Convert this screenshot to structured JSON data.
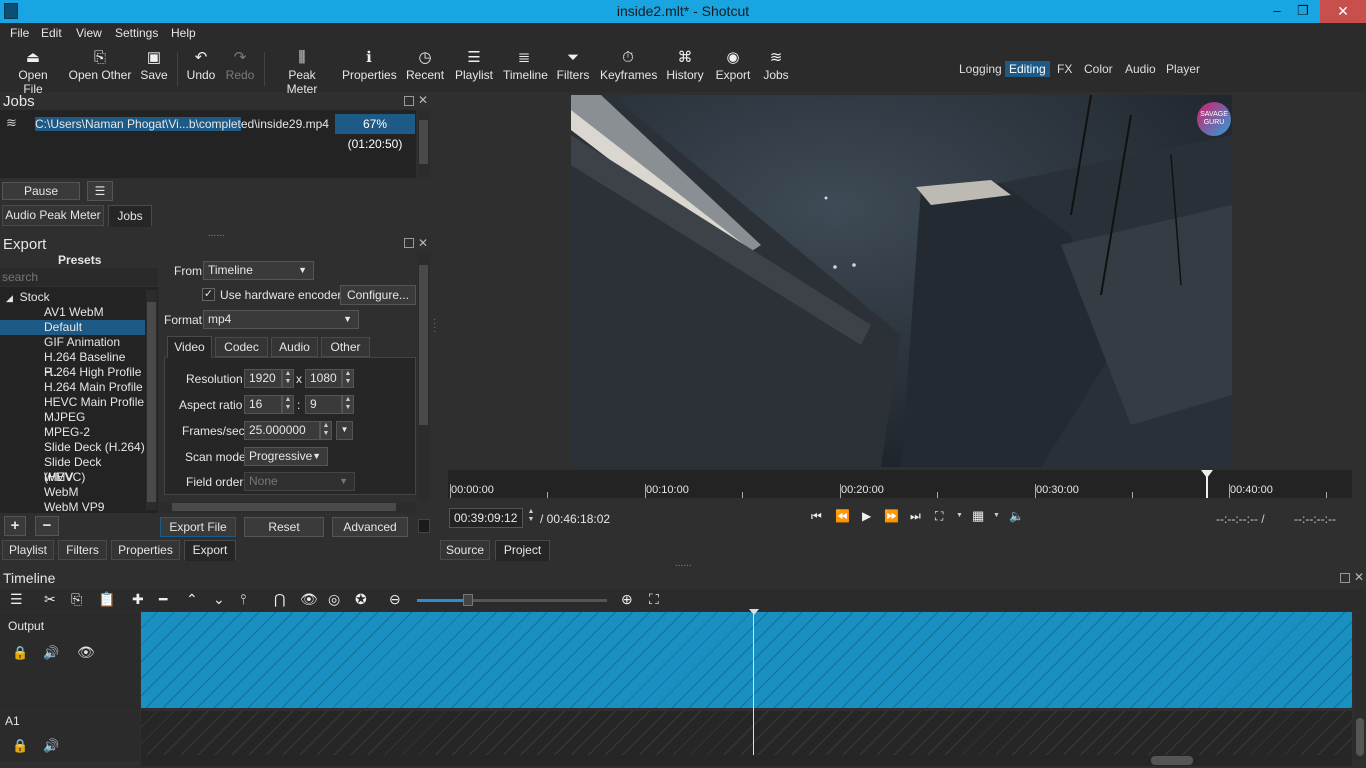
{
  "window": {
    "title": "inside2.mlt* - Shotcut",
    "controls": {
      "minimize": "–",
      "maximize": "❐",
      "close": "✕"
    }
  },
  "menu": [
    "File",
    "Edit",
    "View",
    "Settings",
    "Help"
  ],
  "toolbar": {
    "open_file": "Open File",
    "open_other": "Open Other",
    "save": "Save",
    "undo": "Undo",
    "redo": "Redo",
    "peak_meter": "Peak Meter",
    "properties": "Properties",
    "recent": "Recent",
    "playlist": "Playlist",
    "timeline": "Timeline",
    "filters": "Filters",
    "keyframes": "Keyframes",
    "history": "History",
    "export": "Export",
    "jobs": "Jobs"
  },
  "layouts": {
    "logging": "Logging",
    "editing": "Editing",
    "fx": "FX",
    "color": "Color",
    "audio": "Audio",
    "player": "Player",
    "active": "Editing"
  },
  "jobs_panel": {
    "title": "Jobs",
    "job_path_selected": "C:\\Users\\Naman Phogat\\Vi...b\\complet",
    "job_path_rest": "ed\\inside29.mp4",
    "job_progress": "67% (01:20:50)",
    "pause_button": "Pause",
    "tabs": {
      "audio_peak_meter": "Audio Peak Meter",
      "jobs": "Jobs"
    }
  },
  "export_panel": {
    "title": "Export",
    "presets_label": "Presets",
    "search_placeholder": "search",
    "stock_label": "Stock",
    "presets": [
      "AV1 WebM",
      "Default",
      "GIF Animation",
      "H.264 Baseline P...",
      "H.264 High Profile",
      "H.264 Main Profile",
      "HEVC Main Profile",
      "MJPEG",
      "MPEG-2",
      "Slide Deck (H.264)",
      "Slide Deck (HEVC)",
      "WMV",
      "WebM",
      "WebM VP9"
    ],
    "selected_preset": "Default",
    "from_label": "From",
    "from_value": "Timeline",
    "hw_encoder_label": "Use hardware encoder",
    "configure_button": "Configure...",
    "format_label": "Format",
    "format_value": "mp4",
    "tabs": {
      "video": "Video",
      "codec": "Codec",
      "audio": "Audio",
      "other": "Other"
    },
    "resolution_label": "Resolution",
    "resolution_w": "1920",
    "resolution_x": "x",
    "resolution_h": "1080",
    "aspect_label": "Aspect ratio",
    "aspect_w": "16",
    "aspect_sep": ":",
    "aspect_h": "9",
    "fps_label": "Frames/sec",
    "fps_value": "25.000000",
    "scan_label": "Scan mode",
    "scan_value": "Progressive",
    "field_order_label": "Field order",
    "field_order_value": "None",
    "export_file_button": "Export File",
    "reset_button": "Reset",
    "advanced_button": "Advanced"
  },
  "bottom_tabs": {
    "playlist": "Playlist",
    "filters": "Filters",
    "properties": "Properties",
    "export": "Export"
  },
  "player": {
    "watermark": "SAVAGE GURU",
    "ruler_labels": [
      "00:00:00",
      "00:10:00",
      "00:20:00",
      "00:30:00",
      "00:40:00"
    ],
    "playhead_fraction": 0.84,
    "current_time": "00:39:09:12",
    "total_time": "/ 00:46:18:02",
    "in_point": "--:--:--:-- /",
    "out_point": "--:--:--:--",
    "tabs": {
      "source": "Source",
      "project": "Project"
    }
  },
  "timeline": {
    "title": "Timeline",
    "tracks": {
      "output": "Output",
      "a1": "A1"
    },
    "zoom_level": 0.27
  },
  "colors": {
    "accent": "#19a5e1",
    "selection": "#1e5a86",
    "track_video": "#1a8fc1"
  }
}
